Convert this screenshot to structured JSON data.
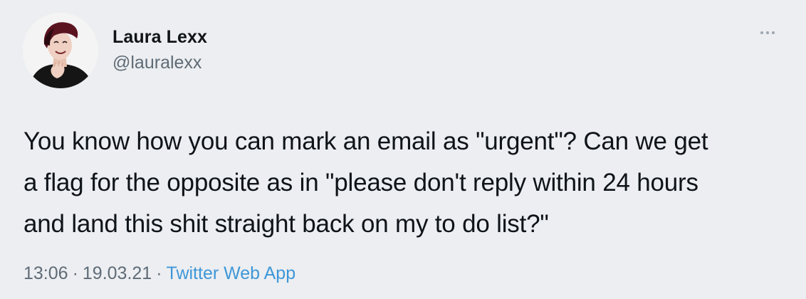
{
  "tweet": {
    "author": {
      "display_name": "Laura Lexx",
      "handle": "@lauralexx"
    },
    "text": "You know how you can mark an email as \"urgent\"? Can we get\na flag for the opposite as in \"please don't reply within 24 hours\nand land this shit straight back on my to do list?\"",
    "time": "13:06",
    "date": "19.03.21",
    "separator": "·",
    "source": "Twitter Web App",
    "more_icon": "more-horizontal-icon"
  },
  "colors": {
    "background": "#eceef1",
    "text": "#0f1419",
    "secondary_text": "#5f6b76",
    "link": "#3f97d8"
  }
}
